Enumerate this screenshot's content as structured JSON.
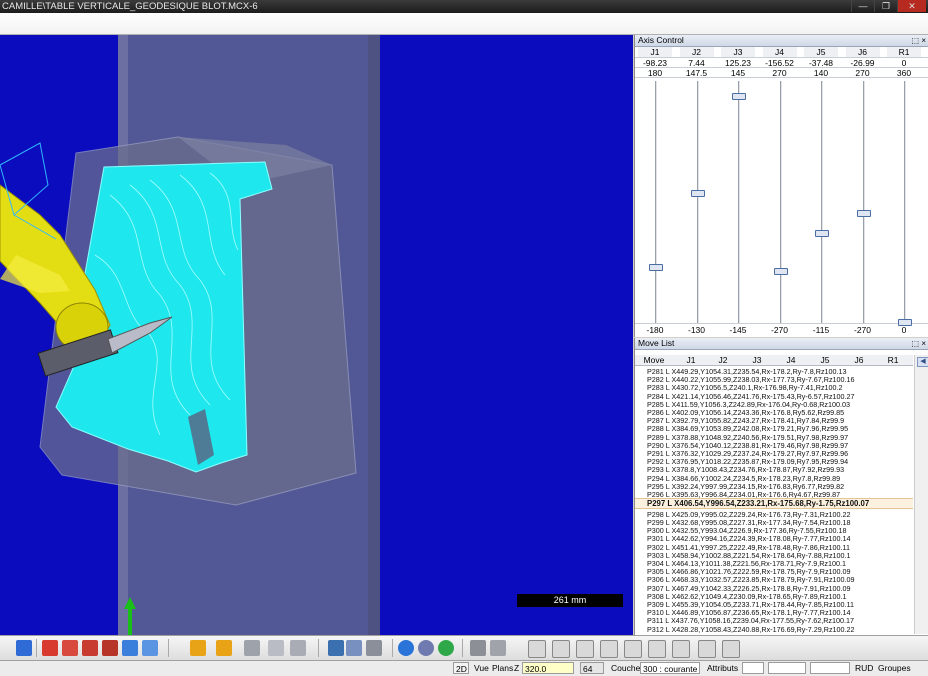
{
  "window": {
    "title": "CAMILLE\\TABLE VERTICALE_GEODESIQUE BLOT.MCX-6"
  },
  "viewport": {
    "scale_label": "261 mm"
  },
  "axis_control": {
    "title": "Axis Control",
    "pin": "⬚ ×",
    "columns": [
      "J1",
      "J2",
      "J3",
      "J4",
      "J5",
      "J6",
      "R1"
    ],
    "current": [
      "-98.23",
      "7.44",
      "125.23",
      "-156.52",
      "-37.48",
      "-26.99",
      "0"
    ],
    "max": [
      "180",
      "147.5",
      "145",
      "270",
      "140",
      "270",
      "360"
    ],
    "min": [
      "-180",
      "-130",
      "-145",
      "-270",
      "-115",
      "-270",
      "0"
    ],
    "levels": [
      0.227,
      0.531,
      0.932,
      0.21,
      0.366,
      0.45,
      0.0
    ]
  },
  "move_list": {
    "title": "Move List",
    "pin": "⬚ ×",
    "columns": [
      "Move",
      "J1",
      "J2",
      "J3",
      "J4",
      "J5",
      "J6",
      "R1"
    ],
    "selected_index": 16,
    "rows": [
      "P281 L X449.29,Y1054.31,Z235.54,Rx-178.2,Ry-7.8,Rz100.13",
      "P282 L X440.22,Y1055.99,Z238.03,Rx-177.73,Ry-7.67,Rz100.16",
      "P283 L X430.72,Y1056.5,Z240.1,Rx-176.98,Ry-7.41,Rz100.2",
      "P284 L X421.14,Y1056.46,Z241.76,Rx-175.43,Ry-6.57,Rz100.27",
      "P285 L X411.59,Y1056.3,Z242.89,Rx-176.04,Ry-0.68,Rz100.03",
      "P286 L X402.09,Y1056.14,Z243.36,Rx-176.8,Ry5.62,Rz99.85",
      "P287 L X392.79,Y1055.82,Z243.27,Rx-178.41,Ry7.84,Rz99.9",
      "P288 L X384.69,Y1053.89,Z242.08,Rx-179.21,Ry7.96,Rz99.95",
      "P289 L X378.88,Y1048.92,Z240.56,Rx-179.51,Ry7.98,Rz99.97",
      "P290 L X376.54,Y1040.12,Z238.81,Rx-179.46,Ry7.98,Rz99.97",
      "P291 L X376.32,Y1029.29,Z237.24,Rx-179.27,Ry7.97,Rz99.96",
      "P292 L X376.95,Y1018.22,Z235.87,Rx-179.09,Ry7.95,Rz99.94",
      "P293 L X378.8,Y1008.43,Z234.76,Rx-178.87,Ry7.92,Rz99.93",
      "P294 L X384.66,Y1002.24,Z234.5,Rx-178.23,Ry7.8,Rz99.89",
      "P295 L X392.24,Y997.99,Z234.15,Rx-176.83,Ry6.77,Rz99.82",
      "P296 L X395.63,Y996.84,Z234.01,Rx-176.6,Ry4.67,Rz99.87",
      "P297 L X406.54,Y996.54,Z233.21,Rx-175.68,Ry-1.75,Rz100.07",
      "P298 L X425.09,Y995.02,Z229.24,Rx-176.73,Ry-7.31,Rz100.22",
      "P299 L X432.68,Y995.08,Z227.31,Rx-177.34,Ry-7.54,Rz100.18",
      "P300 L X432.55,Y993.04,Z226.9,Rx-177.36,Ry-7.55,Rz100.18",
      "P301 L X442.62,Y994.16,Z224.39,Rx-178.08,Ry-7.77,Rz100.14",
      "P302 L X451.41,Y997.25,Z222.49,Rx-178.48,Ry-7.86,Rz100.11",
      "P303 L X458.94,Y1002.88,Z221.54,Rx-178.64,Ry-7.88,Rz100.1",
      "P304 L X464.13,Y1011.38,Z221.56,Rx-178.71,Ry-7.9,Rz100.1",
      "P305 L X466.86,Y1021.76,Z222.59,Rx-178.75,Ry-7.9,Rz100.09",
      "P306 L X468.33,Y1032.57,Z223.85,Rx-178.79,Ry-7.91,Rz100.09",
      "P307 L X467.49,Y1042.33,Z226.25,Rx-178.8,Ry-7.91,Rz100.09",
      "P308 L X462.62,Y1049.4,Z230.09,Rx-178.65,Ry-7.89,Rz100.1",
      "P309 L X455.39,Y1054.05,Z233.71,Rx-178.44,Ry-7.85,Rz100.11",
      "P310 L X446.89,Y1056.87,Z236.65,Rx-178.1,Ry-7.77,Rz100.14",
      "P311 L X437.76,Y1058.16,Z239.04,Rx-177.55,Ry-7.62,Rz100.17",
      "P312 L X428.28,Y1058.43,Z240.88,Rx-176.69,Ry-7.29,Rz100.22"
    ]
  },
  "statusbar": {
    "mode_2d": "2D",
    "vue": "Vue",
    "plans": "Plans",
    "z_label": "Z",
    "z_value": "320.0",
    "layer_num": "64",
    "couche_label": "Couche",
    "couche_value": "300 : courante",
    "attributs": "Attributs",
    "rud": "RUD",
    "groupes": "Groupes"
  }
}
